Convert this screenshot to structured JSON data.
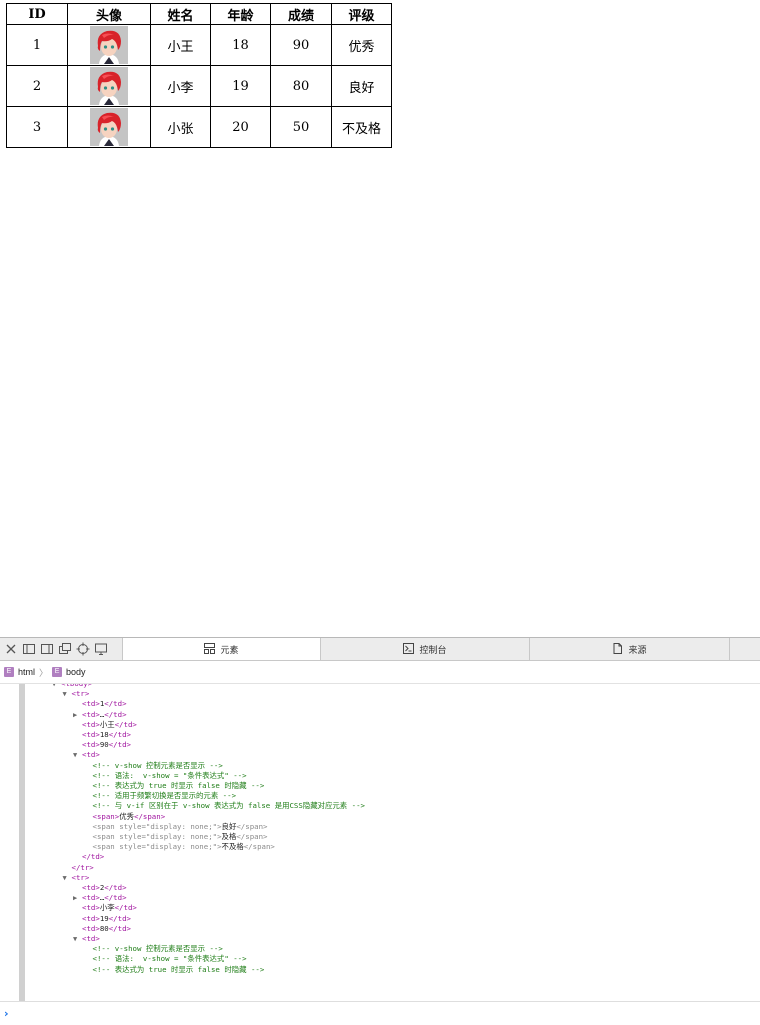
{
  "table": {
    "headers": [
      "ID",
      "头像",
      "姓名",
      "年龄",
      "成绩",
      "评级"
    ],
    "rows": [
      {
        "id": "1",
        "name": "小王",
        "age": "18",
        "score": "90",
        "grade": "优秀"
      },
      {
        "id": "2",
        "name": "小李",
        "age": "19",
        "score": "80",
        "grade": "良好"
      },
      {
        "id": "3",
        "name": "小张",
        "age": "20",
        "score": "50",
        "grade": "不及格"
      }
    ]
  },
  "devtools": {
    "tabs": {
      "elements": "元素",
      "console": "控制台",
      "sources": "来源"
    },
    "breadcrumb": {
      "html": "html",
      "body": "body"
    },
    "tree": [
      {
        "indent": 0,
        "arrow": "▼",
        "parts": [
          [
            "tag",
            "<tbody>"
          ]
        ]
      },
      {
        "indent": 1,
        "arrow": "▼",
        "parts": [
          [
            "tag",
            "<tr>"
          ]
        ]
      },
      {
        "indent": 2,
        "arrow": "",
        "parts": [
          [
            "tag",
            "<td>"
          ],
          [
            "txt",
            "1"
          ],
          [
            "tag",
            "</td>"
          ]
        ]
      },
      {
        "indent": 2,
        "arrow": "▶",
        "parts": [
          [
            "tag",
            "<td>"
          ],
          [
            "txt",
            "…"
          ],
          [
            "tag",
            "</td>"
          ]
        ]
      },
      {
        "indent": 2,
        "arrow": "",
        "parts": [
          [
            "tag",
            "<td>"
          ],
          [
            "txt",
            "小王"
          ],
          [
            "tag",
            "</td>"
          ]
        ]
      },
      {
        "indent": 2,
        "arrow": "",
        "parts": [
          [
            "tag",
            "<td>"
          ],
          [
            "txt",
            "18"
          ],
          [
            "tag",
            "</td>"
          ]
        ]
      },
      {
        "indent": 2,
        "arrow": "",
        "parts": [
          [
            "tag",
            "<td>"
          ],
          [
            "txt",
            "90"
          ],
          [
            "tag",
            "</td>"
          ]
        ]
      },
      {
        "indent": 2,
        "arrow": "▼",
        "parts": [
          [
            "tag",
            "<td>"
          ]
        ]
      },
      {
        "indent": 3,
        "arrow": "",
        "parts": [
          [
            "cmt",
            "<!-- v-show 控制元素是否显示 -->"
          ]
        ]
      },
      {
        "indent": 3,
        "arrow": "",
        "parts": [
          [
            "cmt",
            "<!-- 语法:  v-show = \"条件表达式\" -->"
          ]
        ]
      },
      {
        "indent": 3,
        "arrow": "",
        "parts": [
          [
            "cmt",
            "<!-- 表达式为 true 时显示 false 时隐藏 -->"
          ]
        ]
      },
      {
        "indent": 3,
        "arrow": "",
        "parts": [
          [
            "cmt",
            "<!-- 适用于频繁切换是否显示的元素 -->"
          ]
        ]
      },
      {
        "indent": 3,
        "arrow": "",
        "parts": [
          [
            "cmt",
            "<!-- 与 v-if 区别在于 v-show 表达式为 false 是用CSS隐藏对应元素 -->"
          ]
        ]
      },
      {
        "indent": 3,
        "arrow": "",
        "parts": [
          [
            "tag",
            "<span>"
          ],
          [
            "txt",
            "优秀"
          ],
          [
            "tag",
            "</span>"
          ]
        ]
      },
      {
        "indent": 3,
        "arrow": "",
        "parts": [
          [
            "hid",
            "<span style=\"display: none;\">"
          ],
          [
            "txt",
            "良好"
          ],
          [
            "hid",
            "</span>"
          ]
        ]
      },
      {
        "indent": 3,
        "arrow": "",
        "parts": [
          [
            "hid",
            "<span style=\"display: none;\">"
          ],
          [
            "txt",
            "及格"
          ],
          [
            "hid",
            "</span>"
          ]
        ]
      },
      {
        "indent": 3,
        "arrow": "",
        "parts": [
          [
            "hid",
            "<span style=\"display: none;\">"
          ],
          [
            "txt",
            "不及格"
          ],
          [
            "hid",
            "</span>"
          ]
        ]
      },
      {
        "indent": 2,
        "arrow": "",
        "parts": [
          [
            "tag",
            "</td>"
          ]
        ]
      },
      {
        "indent": 1,
        "arrow": "",
        "parts": [
          [
            "tag",
            "</tr>"
          ]
        ]
      },
      {
        "indent": 1,
        "arrow": "▼",
        "parts": [
          [
            "tag",
            "<tr>"
          ]
        ]
      },
      {
        "indent": 2,
        "arrow": "",
        "parts": [
          [
            "tag",
            "<td>"
          ],
          [
            "txt",
            "2"
          ],
          [
            "tag",
            "</td>"
          ]
        ]
      },
      {
        "indent": 2,
        "arrow": "▶",
        "parts": [
          [
            "tag",
            "<td>"
          ],
          [
            "txt",
            "…"
          ],
          [
            "tag",
            "</td>"
          ]
        ]
      },
      {
        "indent": 2,
        "arrow": "",
        "parts": [
          [
            "tag",
            "<td>"
          ],
          [
            "txt",
            "小李"
          ],
          [
            "tag",
            "</td>"
          ]
        ]
      },
      {
        "indent": 2,
        "arrow": "",
        "parts": [
          [
            "tag",
            "<td>"
          ],
          [
            "txt",
            "19"
          ],
          [
            "tag",
            "</td>"
          ]
        ]
      },
      {
        "indent": 2,
        "arrow": "",
        "parts": [
          [
            "tag",
            "<td>"
          ],
          [
            "txt",
            "80"
          ],
          [
            "tag",
            "</td>"
          ]
        ]
      },
      {
        "indent": 2,
        "arrow": "▼",
        "parts": [
          [
            "tag",
            "<td>"
          ]
        ]
      },
      {
        "indent": 3,
        "arrow": "",
        "parts": [
          [
            "cmt",
            "<!-- v-show 控制元素是否显示 -->"
          ]
        ]
      },
      {
        "indent": 3,
        "arrow": "",
        "parts": [
          [
            "cmt",
            "<!-- 语法:  v-show = \"条件表达式\" -->"
          ]
        ]
      },
      {
        "indent": 3,
        "arrow": "",
        "parts": [
          [
            "cmt",
            "<!-- 表达式为 true 时显示 false 时隐藏 -->"
          ]
        ]
      }
    ],
    "prompt_symbol": "›",
    "toolbar_icons": [
      "close-icon",
      "dock-left-icon",
      "dock-right-icon",
      "undock-icon",
      "element-picker-icon",
      "device-icon"
    ]
  }
}
